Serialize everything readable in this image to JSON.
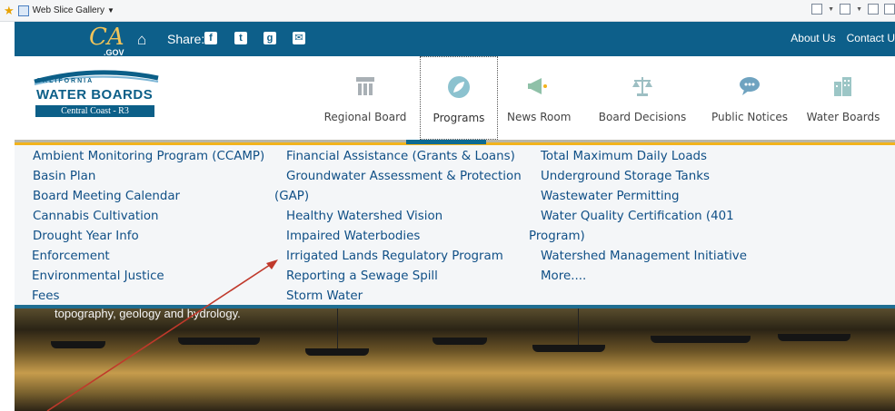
{
  "browser": {
    "favorites_label": "Web Slice Gallery",
    "tool_icons": [
      "home-icon",
      "rss-icon",
      "mail-icon",
      "print-icon"
    ]
  },
  "ca_bar": {
    "logo_text": "CA",
    "logo_suffix": ".GOV",
    "share_label": "Share:",
    "social_icons": [
      "facebook-icon",
      "twitter-icon",
      "google-icon",
      "email-icon"
    ],
    "links": [
      "About Us",
      "Contact U"
    ]
  },
  "logo": {
    "line1": "CALIFORNIA",
    "line2": "WATER BOARDS",
    "line3": "Central Coast - R3"
  },
  "nav": [
    {
      "label": "Regional Board",
      "icon": "org-chart-icon"
    },
    {
      "label": "Programs",
      "icon": "leaf-icon",
      "active": true
    },
    {
      "label": "News Room",
      "icon": "megaphone-icon"
    },
    {
      "label": "Board Decisions",
      "icon": "scales-icon"
    },
    {
      "label": "Public Notices",
      "icon": "speech-bubble-icon"
    },
    {
      "label": "Water Boards",
      "icon": "building-icon"
    }
  ],
  "dropdown": {
    "col1": [
      "Ambient Monitoring Program (CCAMP)",
      "Basin Plan",
      "Board Meeting Calendar",
      "Cannabis Cultivation",
      "Drought Year Info",
      "Enforcement",
      "Environmental Justice",
      "Fees"
    ],
    "col2": [
      "Financial Assistance (Grants & Loans)",
      "Groundwater Assessment & Protection",
      "(GAP)",
      "Healthy Watershed Vision",
      "Impaired Waterbodies",
      "Irrigated Lands Regulatory Program",
      "Reporting a Sewage Spill",
      "Storm Water"
    ],
    "col3": [
      "Total Maximum Daily Loads",
      "Underground Storage Tanks",
      "Wastewater Permitting",
      "Water Quality Certification (401",
      "Program)",
      "Watershed Management Initiative",
      "More...."
    ]
  },
  "hero": {
    "text": "topography, geology and hydrology."
  },
  "colors": {
    "ca_bar": "#0d5f8a",
    "accent": "#f2b31c",
    "link": "#0f4f86",
    "annotation": "#c0392b"
  }
}
